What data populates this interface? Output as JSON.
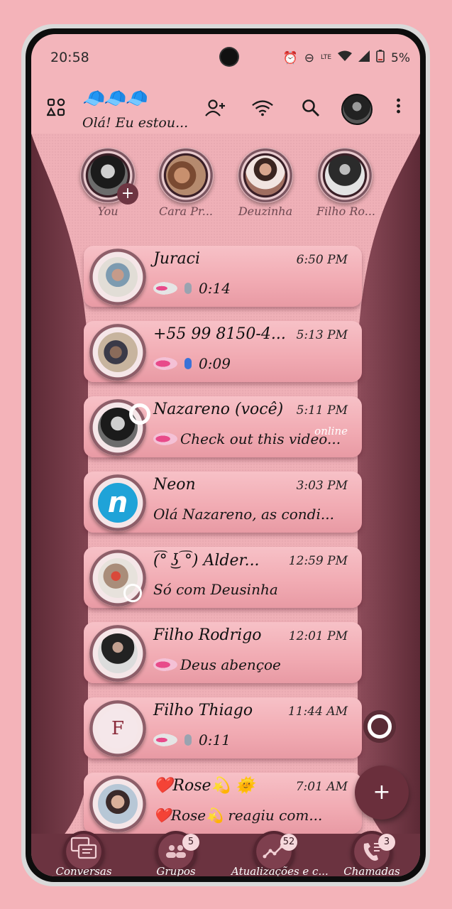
{
  "status_bar": {
    "time": "20:58",
    "battery": "5%",
    "network": "LTE"
  },
  "header": {
    "caps": "🧢🧢🧢",
    "status_text": "Olá! Eu estou...",
    "icons": [
      "grid-icon",
      "add-contact-icon",
      "wifi-icon",
      "search-icon",
      "profile-avatar",
      "more-icon"
    ]
  },
  "stories": [
    {
      "label": "You"
    },
    {
      "label": "Cara Pr..."
    },
    {
      "label": "Deuzinha"
    },
    {
      "label": "Filho Ro..."
    }
  ],
  "chats": [
    {
      "name": "Juraci",
      "time": "6:50 PM",
      "message": "0:14",
      "type": "voice"
    },
    {
      "name": "+55 99 8150-4...",
      "time": "5:13 PM",
      "message": "0:09",
      "type": "voice"
    },
    {
      "name": "Nazareno (você)",
      "time": "5:11 PM",
      "message": "Check out this video...",
      "extra": "online"
    },
    {
      "name": "Neon",
      "time": "3:03 PM",
      "message": "Olá Nazareno, as condi..."
    },
    {
      "name": "(͡° ͜ʖ ͡°) Alder...",
      "time": "12:59 PM",
      "message": "Só com Deusinha"
    },
    {
      "name": "Filho Rodrigo",
      "time": "12:01 PM",
      "message": "Deus abençoe"
    },
    {
      "name": "Filho Thiago",
      "time": "11:44 AM",
      "message": "0:11",
      "type": "voice",
      "initial": "F"
    },
    {
      "name": "❤️Rose💫 🌞",
      "time": "7:01 AM",
      "message": "❤️Rose💫 reagiu com..."
    }
  ],
  "fab": {
    "label": "+"
  },
  "nav": [
    {
      "label": "Conversas"
    },
    {
      "label": "Grupos",
      "badge": "5"
    },
    {
      "label": "Atualizações e c...",
      "badge": "52"
    },
    {
      "label": "Chamadas",
      "badge": "3"
    }
  ],
  "colors": {
    "accent": "#6b3340",
    "background": "#f4b3b9"
  }
}
